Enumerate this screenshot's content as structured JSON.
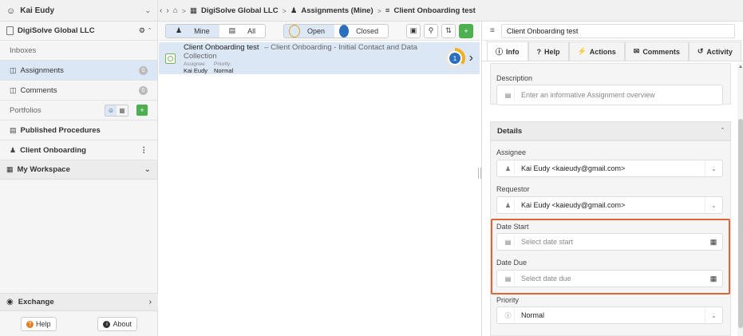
{
  "topbar": {
    "user_name": "Kai Eudy",
    "breadcrumbs": [
      "DigiSolve Global LLC",
      "Assignments (Mine)",
      "Client Onboarding test"
    ]
  },
  "sidebar": {
    "org": "DigiSolve Global LLC",
    "inboxes_label": "Inboxes",
    "items": [
      {
        "label": "Assignments",
        "count": "0"
      },
      {
        "label": "Comments",
        "count": "0"
      }
    ],
    "portfolios_label": "Portfolios",
    "portfolios": [
      {
        "label": "Published Procedures"
      },
      {
        "label": "Client Onboarding"
      }
    ],
    "workspace_label": "My Workspace",
    "exchange_label": "Exchange",
    "help_label": "Help",
    "about_label": "About"
  },
  "middle": {
    "filter_mine": "Mine",
    "filter_all": "All",
    "status_open": "Open",
    "status_closed": "Closed",
    "row": {
      "title": "Client Onboarding test",
      "subtitle": "– Client Onboarding - Initial Contact and Data Collection",
      "assignee_key": "Assignee",
      "assignee_value": "Kai Eudy",
      "priority_key": "Priority:",
      "priority_value": "Normal",
      "progress_label": "1",
      "progress": 0.35
    }
  },
  "right": {
    "title_value": "Client Onboarding test",
    "tabs": [
      "Info",
      "Help",
      "Actions",
      "Comments",
      "Activity"
    ],
    "description_label": "Description",
    "description_placeholder": "Enter an informative Assignment overview",
    "details_label": "Details",
    "assignee_label": "Assignee",
    "assignee_value": "Kai Eudy <kaieudy@gmail.com>",
    "requestor_label": "Requestor",
    "requestor_value": "Kai Eudy <kaieudy@gmail.com>",
    "date_start_label": "Date Start",
    "date_start_placeholder": "Select date start",
    "date_due_label": "Date Due",
    "date_due_placeholder": "Select date due",
    "priority_label": "Priority",
    "priority_value": "Normal"
  },
  "colors": {
    "accent_blue": "#2a6fbf",
    "selected_row": "#dbe7f5",
    "add_green": "#4caf50",
    "highlight": "#e0643a",
    "progress_yellow": "#f2b01e"
  }
}
